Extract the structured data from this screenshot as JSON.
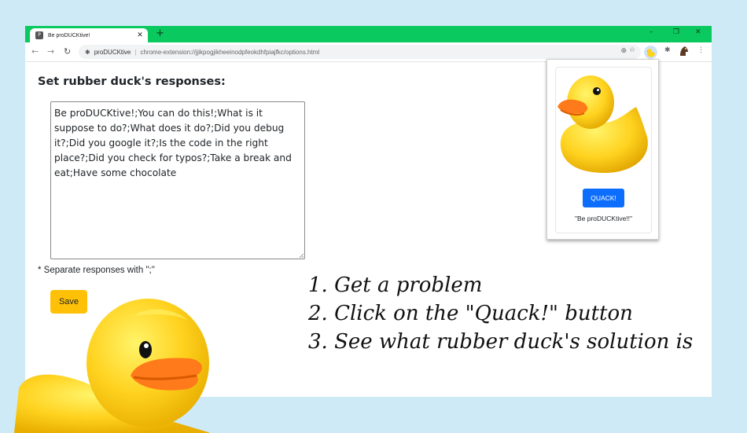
{
  "browser": {
    "tab_title": "Be proDUCKtive!",
    "favicon_icon": "duck-favicon-icon",
    "omnibox": {
      "site_name": "proDUCKtive",
      "url": "chrome-extension://jjikpogjikheeinodpfeokdhfpiajfkc/options.html"
    },
    "accent_color": "#09c95f"
  },
  "options_page": {
    "heading": "Set rubber duck's responses:",
    "responses_value": "Be proDUCKtive!;You can do this!;What is it suppose to do?;What does it do?;Did you debug it?;Did you google it?;Is the code in the right place?;Did you check for typos?;Take a break and eat;Have some chocolate",
    "separator_hint": "* Separate responses with \";\"",
    "save_label": "Save"
  },
  "popup": {
    "quack_label": "QUACK!",
    "response_text": "\"Be proDUCKtive!!\""
  },
  "instructions": [
    "1. Get a problem",
    "2. Click on the \"Quack!\" button",
    "3. See what rubber duck's solution is"
  ],
  "colors": {
    "background": "#cdeaf6",
    "save_button": "#ffc107",
    "quack_button": "#0d6efd",
    "duck_yellow": "#ffd21f",
    "duck_beak": "#ff7a1a"
  }
}
